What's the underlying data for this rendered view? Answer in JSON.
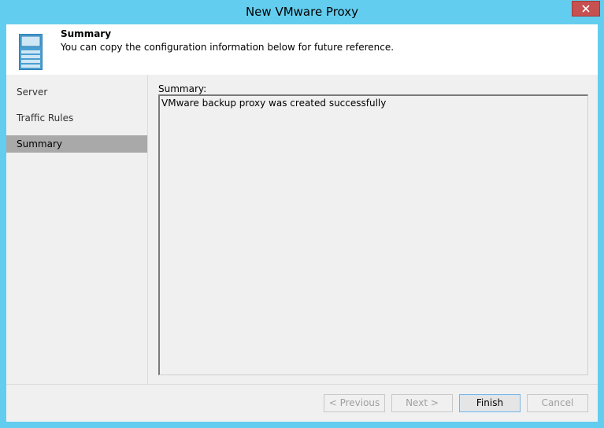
{
  "window": {
    "title": "New VMware Proxy"
  },
  "header": {
    "title": "Summary",
    "description": "You can copy the configuration information below for future reference.",
    "icon": "server-icon"
  },
  "sidebar": {
    "items": [
      {
        "label": "Server",
        "active": false
      },
      {
        "label": "Traffic Rules",
        "active": false
      },
      {
        "label": "Summary",
        "active": true
      }
    ]
  },
  "main": {
    "summary_label": "Summary:",
    "summary_text": "VMware backup proxy was created successfully"
  },
  "footer": {
    "previous_label": "< Previous",
    "next_label": "Next >",
    "finish_label": "Finish",
    "cancel_label": "Cancel"
  },
  "colors": {
    "window_frame": "#63cdef",
    "close_button": "#c75050",
    "active_nav": "#a9a9a9"
  }
}
